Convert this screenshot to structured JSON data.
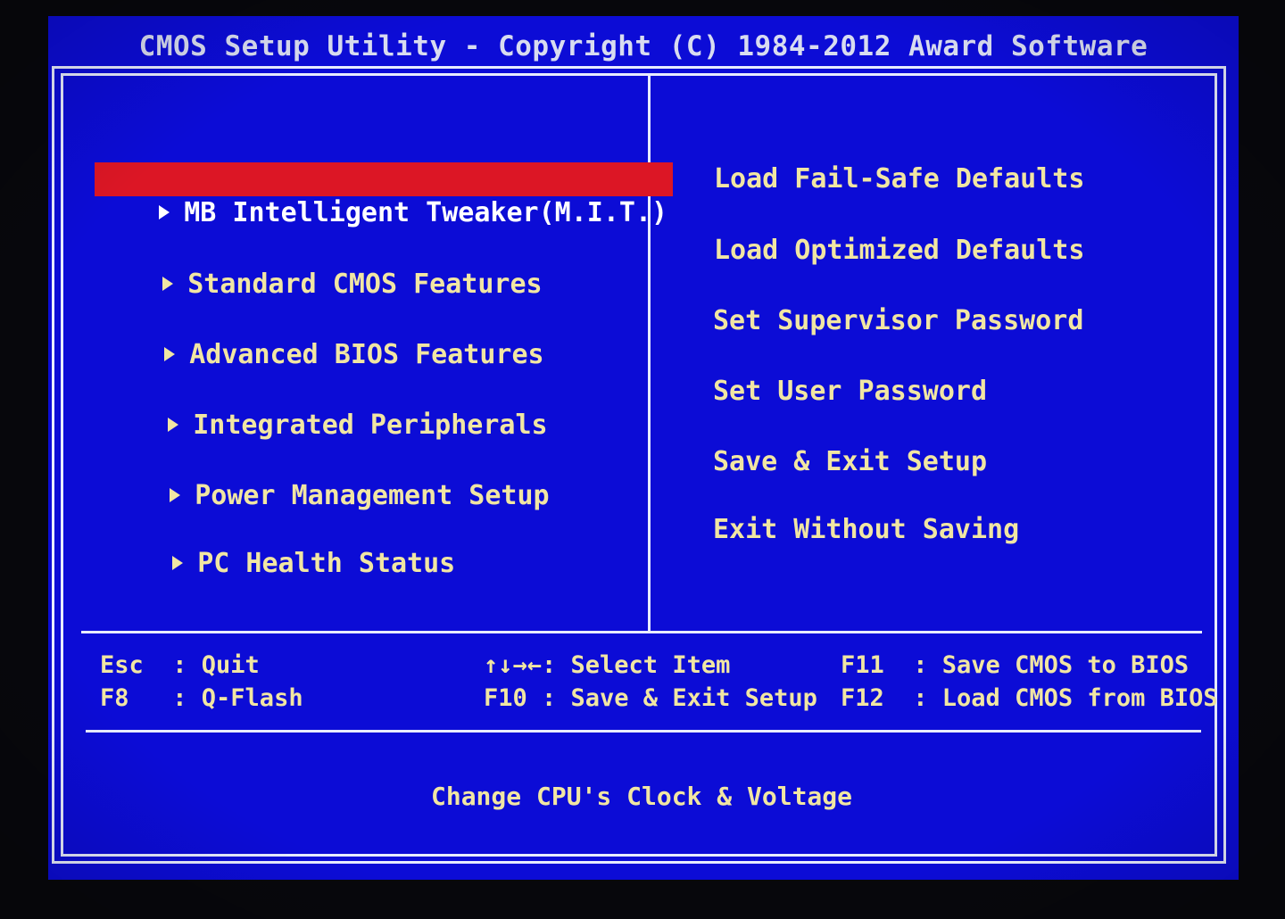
{
  "header": {
    "title": "CMOS Setup Utility - Copyright (C) 1984-2012 Award Software"
  },
  "left_menu": {
    "items": [
      {
        "label": "MB Intelligent Tweaker(M.I.T.)",
        "selected": true
      },
      {
        "label": "Standard CMOS Features",
        "selected": false
      },
      {
        "label": "Advanced BIOS Features",
        "selected": false
      },
      {
        "label": "Integrated Peripherals",
        "selected": false
      },
      {
        "label": "Power Management Setup",
        "selected": false
      },
      {
        "label": "PC Health Status",
        "selected": false
      }
    ]
  },
  "right_menu": {
    "items": [
      {
        "label": "Load Fail-Safe Defaults"
      },
      {
        "label": "Load Optimized Defaults"
      },
      {
        "label": "Set Supervisor Password"
      },
      {
        "label": "Set User Password"
      },
      {
        "label": "Save & Exit Setup"
      },
      {
        "label": "Exit Without Saving"
      }
    ]
  },
  "key_legend": {
    "esc": "Esc  : Quit",
    "f8": "F8   : Q-Flash",
    "arrows": "↑↓→←: Select Item",
    "f10": "F10 : Save & Exit Setup",
    "f11": "F11  : Save CMOS to BIOS",
    "f12": "F12  : Load CMOS from BIOS"
  },
  "help_text": "Change CPU's Clock & Voltage",
  "colors": {
    "background": "#0c0cd6",
    "text": "#f1e6a3",
    "highlight": "#dc1625",
    "frame": "#e8ecff"
  }
}
